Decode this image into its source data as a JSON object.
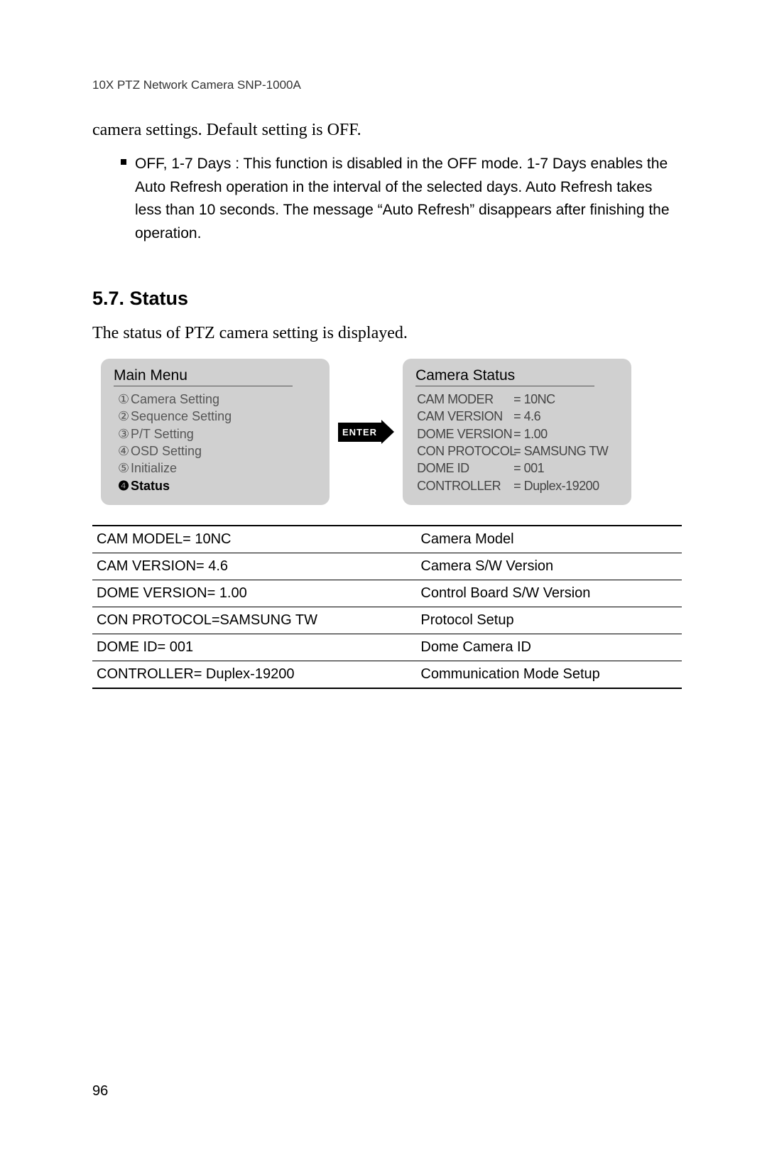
{
  "header": "10X PTZ Network Camera SNP-1000A",
  "intro_line": "camera settings. Default setting is OFF.",
  "bullet_text": "OFF, 1-7 Days : This function is disabled in the OFF mode. 1-7 Days enables the Auto Refresh operation in the interval of the selected days. Auto Refresh takes less than 10 seconds. The message “Auto Refresh” disappears after finishing the operation.",
  "section_heading": "5.7. Status",
  "section_intro": "The status of PTZ camera setting is displayed.",
  "main_menu": {
    "title": "Main Menu",
    "items": [
      {
        "num": "①",
        "label": "Camera Setting"
      },
      {
        "num": "②",
        "label": "Sequence Setting"
      },
      {
        "num": "③",
        "label": "P/T Setting"
      },
      {
        "num": "④",
        "label": "OSD Setting"
      },
      {
        "num": "⑤",
        "label": "Initialize"
      },
      {
        "num": "❹",
        "label": "Status"
      }
    ]
  },
  "enter_label": "ENTER",
  "camera_status": {
    "title": "Camera Status",
    "lines": [
      {
        "label": "CAM MODER",
        "value": "= 10NC"
      },
      {
        "label": "CAM VERSION",
        "value": "= 4.6"
      },
      {
        "label": "DOME VERSION",
        "value": "= 1.00"
      },
      {
        "label": "CON PROTOCOL",
        "value": "= SAMSUNG TW"
      },
      {
        "label": "DOME ID",
        "value": "= 001"
      },
      {
        "label": "CONTROLLER",
        "value": "= Duplex-19200"
      }
    ]
  },
  "status_table": [
    {
      "left": "CAM MODEL= 10NC",
      "right": "Camera Model"
    },
    {
      "left": "CAM VERSION= 4.6",
      "right": "Camera S/W Version"
    },
    {
      "left": "DOME VERSION= 1.00",
      "right": "Control Board S/W Version"
    },
    {
      "left": "CON PROTOCOL=SAMSUNG TW",
      "right": "Protocol Setup"
    },
    {
      "left": "DOME ID= 001",
      "right": "Dome Camera ID"
    },
    {
      "left": "CONTROLLER= Duplex-19200",
      "right": "Communication Mode Setup"
    }
  ],
  "page_number": "96"
}
